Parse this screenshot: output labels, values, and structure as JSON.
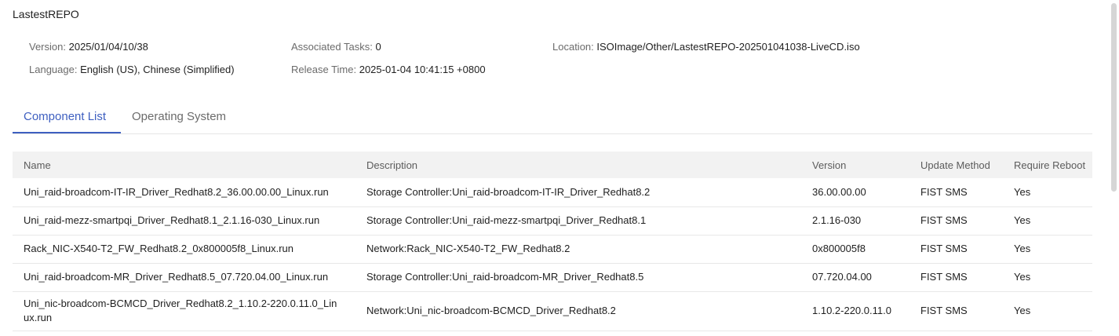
{
  "title": "LastestREPO",
  "meta": {
    "version_label": "Version:",
    "version_value": "2025/01/04/10/38",
    "language_label": "Language:",
    "language_value": "English (US), Chinese (Simplified)",
    "tasks_label": "Associated Tasks:",
    "tasks_value": "0",
    "release_label": "Release Time:",
    "release_value": "2025-01-04 10:41:15 +0800",
    "location_label": "Location:",
    "location_value": "ISOImage/Other/LastestREPO-202501041038-LiveCD.iso"
  },
  "tabs": [
    {
      "label": "Component List",
      "active": true
    },
    {
      "label": "Operating System",
      "active": false
    }
  ],
  "table": {
    "headers": [
      "Name",
      "Description",
      "Version",
      "Update Method",
      "Require Reboot"
    ],
    "rows": [
      [
        "Uni_raid-broadcom-IT-IR_Driver_Redhat8.2_36.00.00.00_Linux.run",
        "Storage Controller:Uni_raid-broadcom-IT-IR_Driver_Redhat8.2",
        "36.00.00.00",
        "FIST SMS",
        "Yes"
      ],
      [
        "Uni_raid-mezz-smartpqi_Driver_Redhat8.1_2.1.16-030_Linux.run",
        "Storage Controller:Uni_raid-mezz-smartpqi_Driver_Redhat8.1",
        "2.1.16-030",
        "FIST SMS",
        "Yes"
      ],
      [
        "Rack_NIC-X540-T2_FW_Redhat8.2_0x800005f8_Linux.run",
        "Network:Rack_NIC-X540-T2_FW_Redhat8.2",
        "0x800005f8",
        "FIST SMS",
        "Yes"
      ],
      [
        "Uni_raid-broadcom-MR_Driver_Redhat8.5_07.720.04.00_Linux.run",
        "Storage Controller:Uni_raid-broadcom-MR_Driver_Redhat8.5",
        "07.720.04.00",
        "FIST SMS",
        "Yes"
      ],
      [
        "Uni_nic-broadcom-BCMCD_Driver_Redhat8.2_1.10.2-220.0.11.0_Linux.run",
        "Network:Uni_nic-broadcom-BCMCD_Driver_Redhat8.2",
        "1.10.2-220.0.11.0",
        "FIST SMS",
        "Yes"
      ]
    ]
  },
  "colors": {
    "accent": "#3e5fc0",
    "header_bg": "#f2f2f2",
    "border": "#e8e8e8"
  }
}
